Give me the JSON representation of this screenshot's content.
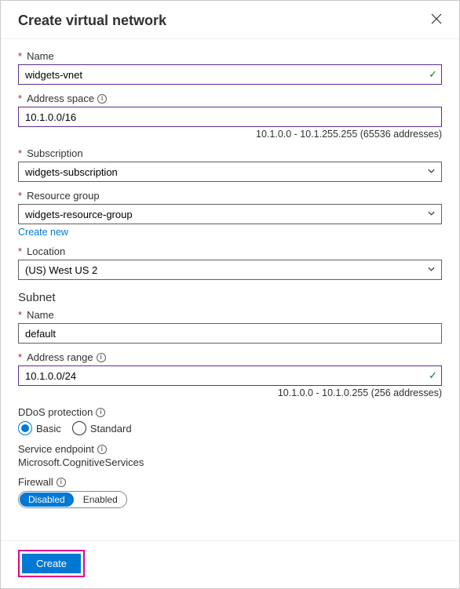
{
  "header": {
    "title": "Create virtual network"
  },
  "fields": {
    "name": {
      "label": "Name",
      "value": "widgets-vnet"
    },
    "address_space": {
      "label": "Address space",
      "value": "10.1.0.0/16",
      "helper": "10.1.0.0 - 10.1.255.255 (65536 addresses)"
    },
    "subscription": {
      "label": "Subscription",
      "value": "widgets-subscription"
    },
    "resource_group": {
      "label": "Resource group",
      "value": "widgets-resource-group",
      "create_new": "Create new"
    },
    "location": {
      "label": "Location",
      "value": "(US) West US 2"
    },
    "subnet_heading": "Subnet",
    "subnet_name": {
      "label": "Name",
      "value": "default"
    },
    "subnet_range": {
      "label": "Address range",
      "value": "10.1.0.0/24",
      "helper": "10.1.0.0 - 10.1.0.255 (256 addresses)"
    },
    "ddos": {
      "label": "DDoS protection",
      "basic": "Basic",
      "standard": "Standard"
    },
    "service_endpoint": {
      "label": "Service endpoint",
      "value": "Microsoft.CognitiveServices"
    },
    "firewall": {
      "label": "Firewall",
      "disabled": "Disabled",
      "enabled": "Enabled"
    }
  },
  "footer": {
    "create": "Create"
  }
}
